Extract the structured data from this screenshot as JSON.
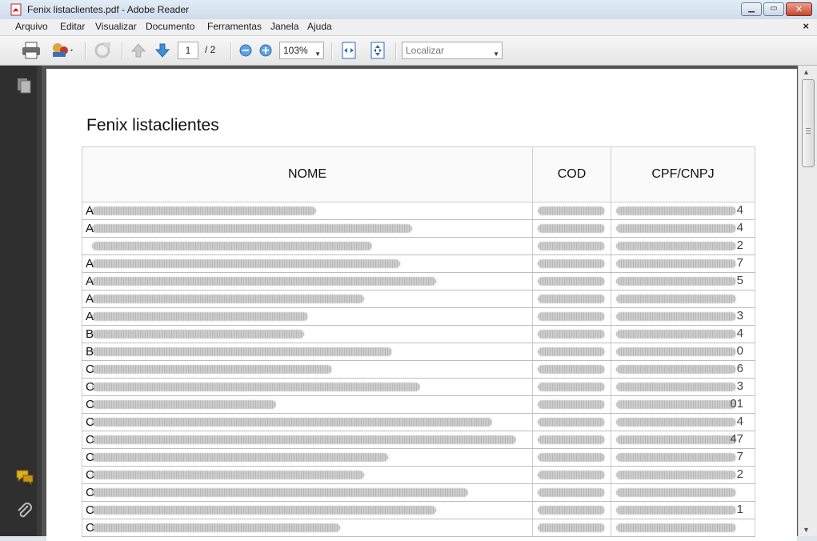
{
  "window": {
    "title": "Fenix listaclientes.pdf - Adobe Reader"
  },
  "menu": {
    "items": [
      "Arquivo",
      "Editar",
      "Visualizar",
      "Documento",
      "Ferramentas",
      "Janela",
      "Ajuda"
    ],
    "close_glyph": "×"
  },
  "toolbar": {
    "page_current": "1",
    "page_total": "/ 2",
    "zoom": "103%",
    "search_placeholder": "Localizar"
  },
  "icons": [
    "pdf-app-icon",
    "minimize-icon",
    "maximize-icon",
    "close-icon",
    "print-icon",
    "share-icon",
    "sync-icon",
    "previous-page-icon",
    "next-page-icon",
    "zoom-out-icon",
    "zoom-in-icon",
    "fit-width-icon",
    "fit-page-icon",
    "pages-panel-icon",
    "comments-icon",
    "attachments-icon"
  ],
  "document": {
    "title": "Fenix listaclientes",
    "headers": {
      "name": "NOME",
      "cod": "COD",
      "doc": "CPF/CNPJ"
    },
    "rows": [
      {
        "lead": "A",
        "tail": "4"
      },
      {
        "lead": "A",
        "tail": "4"
      },
      {
        "lead": "",
        "tail": "2"
      },
      {
        "lead": "A",
        "tail": "7"
      },
      {
        "lead": "A",
        "tail": "5"
      },
      {
        "lead": "A",
        "tail": ""
      },
      {
        "lead": "A",
        "tail": "3"
      },
      {
        "lead": "B",
        "tail": "4"
      },
      {
        "lead": "B",
        "tail": "0"
      },
      {
        "lead": "C",
        "tail": "6"
      },
      {
        "lead": "C",
        "tail": "3"
      },
      {
        "lead": "C",
        "tail": "01"
      },
      {
        "lead": "C",
        "tail": "4"
      },
      {
        "lead": "C",
        "tail": "47"
      },
      {
        "lead": "C",
        "tail": "7"
      },
      {
        "lead": "C",
        "tail": "2"
      },
      {
        "lead": "C",
        "tail": ""
      },
      {
        "lead": "C",
        "tail": "1"
      },
      {
        "lead": "C",
        "tail": ""
      }
    ]
  }
}
